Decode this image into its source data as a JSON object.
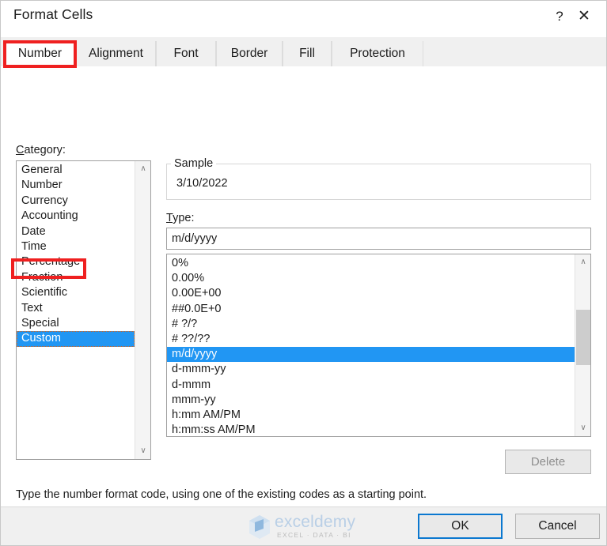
{
  "window": {
    "title": "Format Cells",
    "help_icon": "question-mark-icon",
    "help_label": "?",
    "close_label": "✕"
  },
  "tabs": [
    {
      "label": "Number",
      "selected": true
    },
    {
      "label": "Alignment",
      "selected": false
    },
    {
      "label": "Font",
      "selected": false
    },
    {
      "label": "Border",
      "selected": false
    },
    {
      "label": "Fill",
      "selected": false
    },
    {
      "label": "Protection",
      "selected": false
    }
  ],
  "category": {
    "label_accel": "C",
    "label_rest": "ategory:",
    "items": [
      "General",
      "Number",
      "Currency",
      "Accounting",
      "Date",
      "Time",
      "Percentage",
      "Fraction",
      "Scientific",
      "Text",
      "Special",
      "Custom"
    ],
    "selected": "Custom",
    "scroll_up": "∧",
    "scroll_down": "∨"
  },
  "sample": {
    "legend": "Sample",
    "value": "3/10/2022"
  },
  "type": {
    "label_accel": "T",
    "label_rest": "ype:",
    "input_value": "m/d/yyyy",
    "items": [
      "0%",
      "0.00%",
      "0.00E+00",
      "##0.0E+0",
      "# ?/?",
      "# ??/??",
      "m/d/yyyy",
      "d-mmm-yy",
      "d-mmm",
      "mmm-yy",
      "h:mm AM/PM",
      "h:mm:ss AM/PM"
    ],
    "selected": "m/d/yyyy",
    "scroll_up": "∧",
    "scroll_down": "∨"
  },
  "delete_button": {
    "label": "Delete",
    "enabled": false
  },
  "help_text": "Type the number format code, using one of the existing codes as a starting point.",
  "footer": {
    "ok_label": "OK",
    "cancel_label": "Cancel"
  },
  "watermark": {
    "name": "exceldemy",
    "tagline": "EXCEL · DATA · BI"
  },
  "annotations": [
    {
      "name": "number-tab-highlight",
      "color": "#ef2020"
    },
    {
      "name": "custom-category-highlight",
      "color": "#ef2020"
    }
  ]
}
